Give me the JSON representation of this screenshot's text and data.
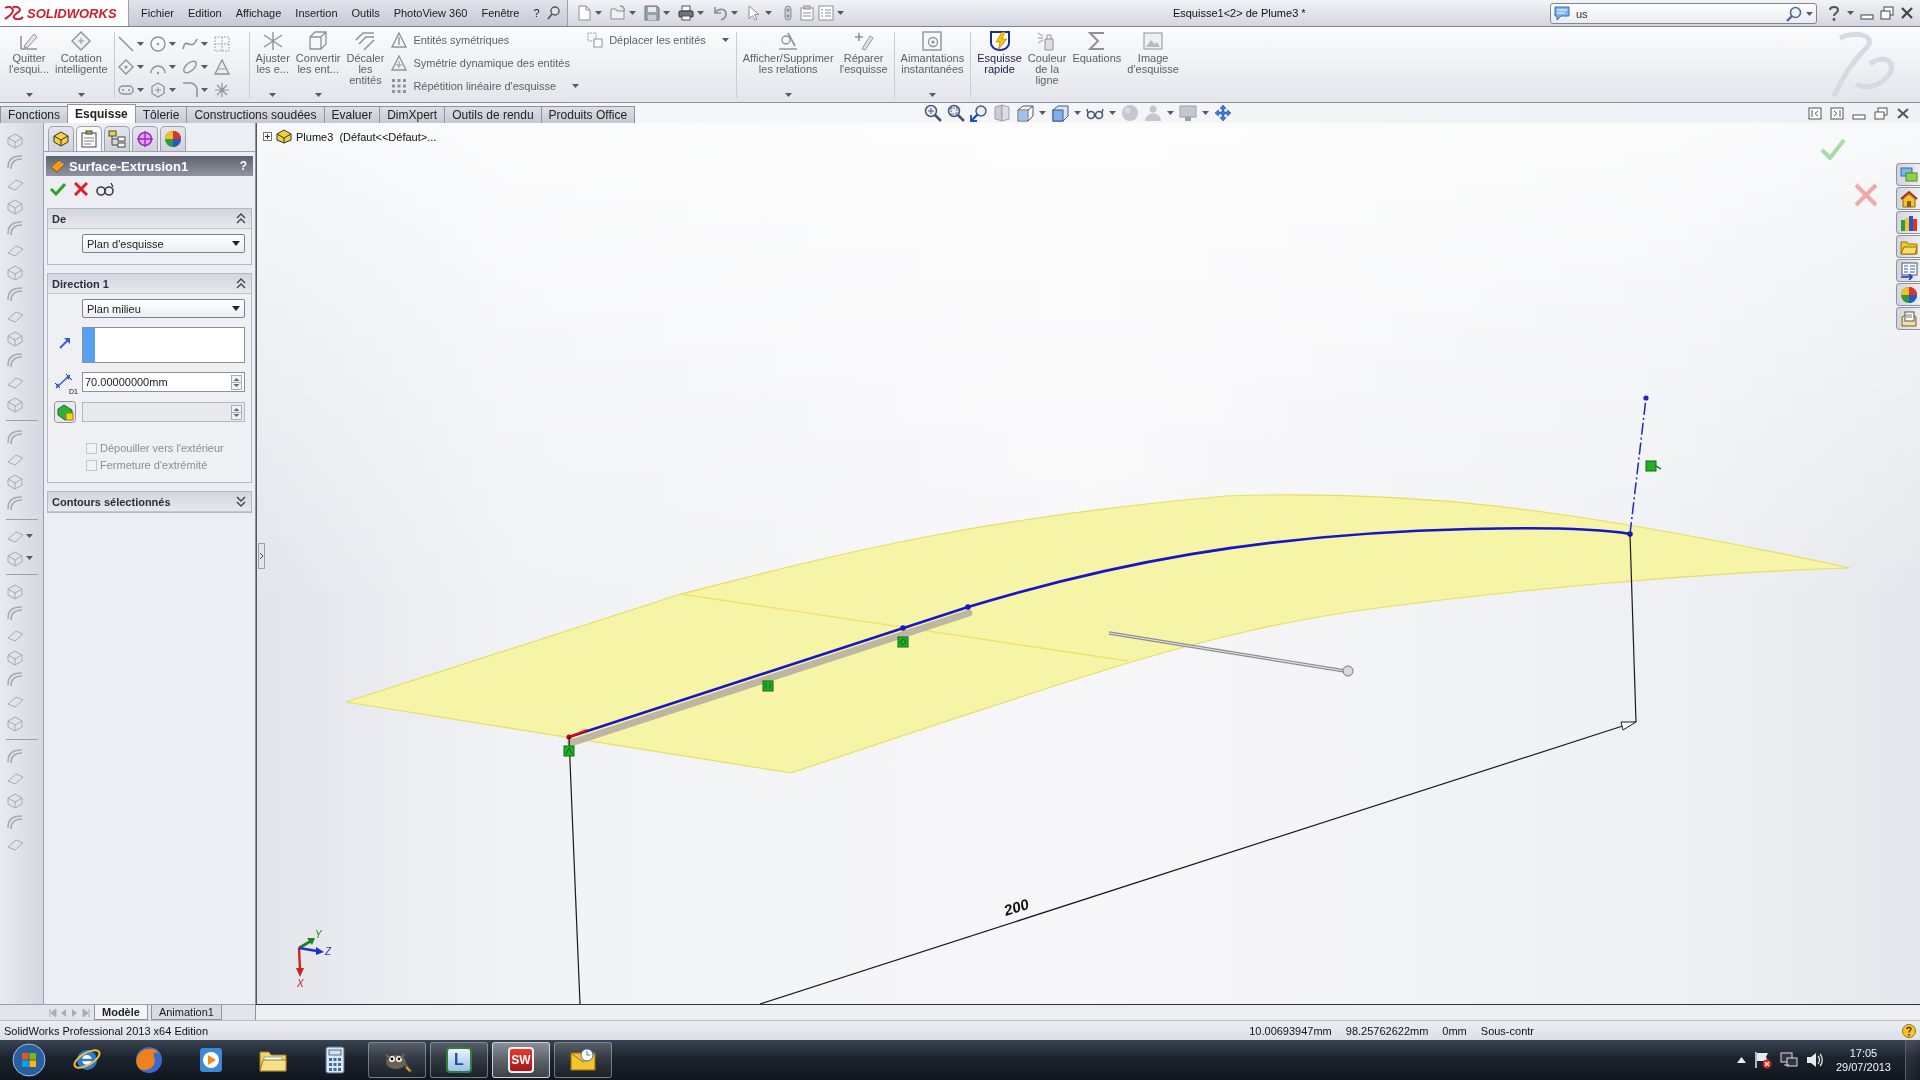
{
  "title_bar": {
    "logo": "SOLIDWORKS",
    "menu": [
      {
        "label": "Fichier"
      },
      {
        "label": "Edition"
      },
      {
        "label": "Affichage"
      },
      {
        "label": "Insertion"
      },
      {
        "label": "Outils"
      },
      {
        "label": "PhotoView 360"
      },
      {
        "label": "Fenêtre"
      },
      {
        "label": "?"
      }
    ],
    "title": "Esquisse1<2> de Plume3 *",
    "search": {
      "value": "us"
    }
  },
  "command_manager": {
    "items": [
      {
        "kind": "large",
        "label": "Quitter\nl'esqui...",
        "disabled": true,
        "menu": true
      },
      {
        "kind": "large",
        "label": "Cotation\nintelligente",
        "disabled": true,
        "menu": true
      },
      {
        "kind": "separator"
      },
      {
        "kind": "grid"
      },
      {
        "kind": "separator"
      },
      {
        "kind": "large",
        "label": "Ajuster\nles e...",
        "disabled": true,
        "menu": true
      },
      {
        "kind": "large",
        "label": "Convertir\nles ent...",
        "disabled": true,
        "menu": true
      },
      {
        "kind": "large",
        "label": "Décaler\nles\nentités",
        "disabled": true,
        "menu": false
      },
      {
        "kind": "stack",
        "items": [
          {
            "label": "Entités symétriques",
            "disabled": true,
            "menu": false
          },
          {
            "label": "Symétrie dynamique des entités",
            "disabled": true,
            "menu": false
          },
          {
            "label": "Répétition linéaire d'esquisse",
            "disabled": true,
            "menu": true
          }
        ]
      },
      {
        "kind": "stack",
        "items": [
          {
            "label": "Déplacer les entités",
            "disabled": true,
            "menu": true
          }
        ]
      },
      {
        "kind": "separator"
      },
      {
        "kind": "large",
        "label": "Afficher/Supprimer\nles relations",
        "disabled": true,
        "menu": true
      },
      {
        "kind": "large",
        "label": "Réparer\nl'esquisse",
        "disabled": true,
        "menu": false
      },
      {
        "kind": "separator"
      },
      {
        "kind": "large",
        "label": "Aimantations\ninstantanées",
        "disabled": true,
        "menu": true
      },
      {
        "kind": "separator"
      },
      {
        "kind": "large",
        "label": "Esquisse\nrapide",
        "disabled": false,
        "menu": false
      },
      {
        "kind": "large",
        "label": "Couleur\nde la\nligne",
        "disabled": true,
        "menu": false
      },
      {
        "kind": "large",
        "label": "Equations",
        "disabled": true,
        "menu": false
      },
      {
        "kind": "large",
        "label": "Image\nd'esquisse",
        "disabled": true,
        "menu": false
      }
    ]
  },
  "tabs": [
    {
      "label": "Fonctions",
      "selected": false
    },
    {
      "label": "Esquisse",
      "selected": true
    },
    {
      "label": "Tôlerie",
      "selected": false
    },
    {
      "label": "Constructions soudées",
      "selected": false
    },
    {
      "label": "Evaluer",
      "selected": false
    },
    {
      "label": "DimXpert",
      "selected": false
    },
    {
      "label": "Outils de rendu",
      "selected": false
    },
    {
      "label": "Produits Office",
      "selected": false
    }
  ],
  "property_manager": {
    "tabs": [
      {
        "selected": false
      },
      {
        "selected": true
      },
      {
        "selected": false
      },
      {
        "selected": false
      },
      {
        "selected": false
      }
    ],
    "title": "Surface-Extrusion1",
    "help": "?",
    "groups": [
      {
        "title": "De",
        "expanded": true,
        "rows": [
          {
            "kind": "dropdown",
            "value": "Plan d'esquisse"
          }
        ]
      },
      {
        "title": "Direction 1",
        "expanded": true,
        "rows": [
          {
            "kind": "dropdown",
            "value": "Plan milieu"
          },
          {
            "kind": "direction_box"
          },
          {
            "kind": "depth_field",
            "tag": "D1",
            "value": "70.00000000mm",
            "disabled": false
          },
          {
            "kind": "draft_field",
            "disabled": true
          },
          {
            "kind": "checkbox",
            "label": "Dépouiller vers l'extérieur",
            "checked": false,
            "disabled": true
          },
          {
            "kind": "checkbox",
            "label": "Fermeture d'extrémité",
            "checked": false,
            "disabled": true
          }
        ]
      },
      {
        "title": "Contours sélectionnés",
        "expanded": false
      }
    ]
  },
  "graphics": {
    "tree_flyout": "Plume3  (Défaut<<Défaut>...",
    "dimension": "200",
    "triad": {
      "x_label": "X",
      "y_label": "Y",
      "z_label": "Z"
    }
  },
  "panel_tabs": [
    {
      "label": "Modèle",
      "selected": true
    },
    {
      "label": "Animation1",
      "selected": false
    }
  ],
  "status_bar": {
    "text": "SolidWorks Professional 2013 x64 Edition",
    "readouts": [
      "10.00693947mm",
      "98.25762622mm",
      "0mm",
      "Sous-contr"
    ]
  },
  "taskbar": {
    "apps": [
      {
        "kind": "browser",
        "running": false,
        "selected": false
      },
      {
        "kind": "fox",
        "running": false,
        "selected": false
      },
      {
        "kind": "player",
        "running": false,
        "selected": false
      },
      {
        "kind": "files",
        "running": false,
        "selected": false
      },
      {
        "kind": "calculator",
        "running": false,
        "selected": false
      },
      {
        "kind": "mascot",
        "running": true,
        "selected": false
      },
      {
        "kind": "letter",
        "label": "L",
        "running": true,
        "selected": false
      },
      {
        "kind": "letter",
        "label": "SW",
        "running": true,
        "selected": true
      },
      {
        "kind": "mail",
        "running": true,
        "selected": false
      }
    ],
    "clock": {
      "time": "17:05",
      "date": "29/07/2013"
    }
  }
}
